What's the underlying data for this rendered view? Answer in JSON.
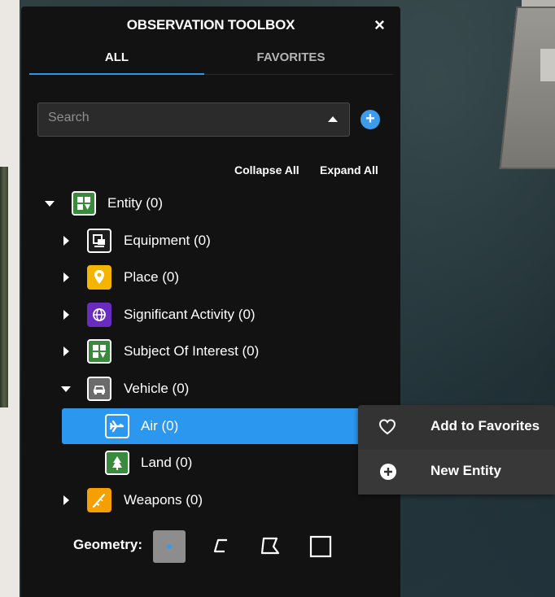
{
  "panel": {
    "title": "OBSERVATION TOOLBOX",
    "close_label": "×",
    "tabs": [
      {
        "label": "ALL",
        "active": true
      },
      {
        "label": "FAVORITES",
        "active": false
      }
    ],
    "search": {
      "placeholder": "Search",
      "value": ""
    },
    "add_label": "+",
    "links": {
      "collapse": "Collapse All",
      "expand": "Expand All"
    },
    "tree": {
      "entity": {
        "label": "Entity (0)",
        "icon": "grid-icon",
        "expanded": true
      },
      "equipment": {
        "label": "Equipment (0)",
        "icon": "equipment-icon"
      },
      "place": {
        "label": "Place (0)",
        "icon": "map-pin-icon"
      },
      "activity": {
        "label": "Significant Activity (0)",
        "icon": "globe-icon"
      },
      "subject": {
        "label": "Subject Of Interest (0)",
        "icon": "grid-icon"
      },
      "vehicle": {
        "label": "Vehicle (0)",
        "icon": "car-icon",
        "expanded": true
      },
      "air": {
        "label": "Air (0)",
        "icon": "plane-icon",
        "selected": true
      },
      "land": {
        "label": "Land (0)",
        "icon": "tree-icon"
      },
      "weapons": {
        "label": "Weapons (0)",
        "icon": "rifle-icon"
      }
    },
    "geometry": {
      "label": "Geometry:",
      "options": [
        "point",
        "polyline",
        "polygon",
        "rectangle"
      ],
      "selected": "point"
    },
    "colors": {
      "accent": "#2b97ee",
      "panel_bg": "#121212",
      "entity": "#3a8a3e",
      "place": "#f5b400",
      "activity": "#6a2bbf",
      "weapons": "#f5a000"
    }
  },
  "context_menu": {
    "items": [
      {
        "label": "Add to Favorites",
        "icon": "heart-icon"
      },
      {
        "label": "New Entity",
        "icon": "plus-circle-icon"
      }
    ]
  }
}
